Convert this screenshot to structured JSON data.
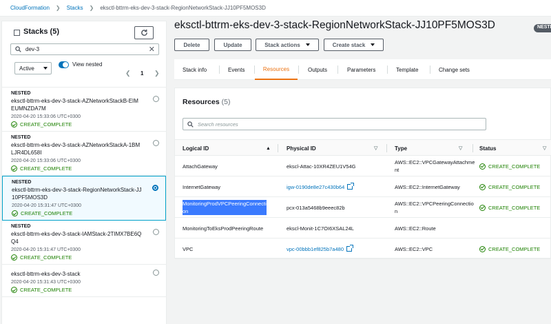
{
  "breadcrumb": {
    "root": "CloudFormation",
    "mid": "Stacks",
    "current": "eksctl-bttrm-eks-dev-3-stack-RegionNetworkStack-JJ10PF5MOS3D"
  },
  "left": {
    "title": "Stacks",
    "count": "(5)",
    "search_value": "dev-3",
    "filter_value": "Active",
    "view_nested": "View nested",
    "page": "1",
    "stacks": [
      {
        "tag": "NESTED",
        "name": "eksctl-bttrm-eks-dev-3-stack-AZNetworkStackB-EIMEUMNZDA7M",
        "date": "2020-04-20 15:33:06 UTC+0300",
        "status": "CREATE_COMPLETE",
        "selected": false
      },
      {
        "tag": "NESTED",
        "name": "eksctl-bttrm-eks-dev-3-stack-AZNetworkStackA-1BMLJR4DL658I",
        "date": "2020-04-20 15:33:06 UTC+0300",
        "status": "CREATE_COMPLETE",
        "selected": false
      },
      {
        "tag": "NESTED",
        "name": "eksctl-bttrm-eks-dev-3-stack-RegionNetworkStack-JJ10PF5MOS3D",
        "date": "2020-04-20 15:31:47 UTC+0300",
        "status": "CREATE_COMPLETE",
        "selected": true
      },
      {
        "tag": "NESTED",
        "name": "eksctl-bttrm-eks-dev-3-stack-IAMStack-2TIMX7BE6QQ4",
        "date": "2020-04-20 15:31:47 UTC+0300",
        "status": "CREATE_COMPLETE",
        "selected": false
      },
      {
        "tag": "",
        "name": "eksctl-bttrm-eks-dev-3-stack",
        "date": "2020-04-20 15:31:43 UTC+0300",
        "status": "CREATE_COMPLETE",
        "selected": false
      }
    ]
  },
  "main": {
    "title": "eksctl-bttrm-eks-dev-3-stack-RegionNetworkStack-JJ10PF5MOS3D",
    "badge": "NESTED",
    "buttons": {
      "delete": "Delete",
      "update": "Update",
      "stack_actions": "Stack actions",
      "create_stack": "Create stack"
    },
    "tabs": [
      "Stack info",
      "Events",
      "Resources",
      "Outputs",
      "Parameters",
      "Template",
      "Change sets"
    ],
    "active_tab": "Resources",
    "resources": {
      "title": "Resources",
      "count": "(5)",
      "search_placeholder": "Search resources",
      "columns": [
        "Logical ID",
        "Physical ID",
        "Type",
        "Status"
      ],
      "rows": [
        {
          "logical": "AttachGateway",
          "physical": "ekscl-Attac-10XR4ZEU1V54G",
          "link": false,
          "type": "AWS::EC2::VPCGatewayAttachment",
          "status": "CREATE_COMPLETE"
        },
        {
          "logical": "InternetGateway",
          "physical": "igw-0190de8e27c430b64",
          "link": true,
          "type": "AWS::EC2::InternetGateway",
          "status": "CREATE_COMPLETE"
        },
        {
          "logical": "MonitoringProdVPCPeeringConnection",
          "physical": "pcx-013a5468b9eeec82b",
          "link": false,
          "type": "AWS::EC2::VPCPeeringConnection",
          "status": "CREATE_COMPLETE",
          "highlight": true
        },
        {
          "logical": "MonitoringToEksProdPeeringRoute",
          "physical": "ekscl-Monit-1C7OI6XSAL24L",
          "link": false,
          "type": "AWS::EC2::Route",
          "status": ""
        },
        {
          "logical": "VPC",
          "physical": "vpc-00bbb1ef825b7a480",
          "link": true,
          "type": "AWS::EC2::VPC",
          "status": "CREATE_COMPLETE"
        }
      ]
    }
  },
  "colors": {
    "link": "#0073bb",
    "success": "#1d8102",
    "active_tab": "#ec7211",
    "selection": "#3a7afe"
  }
}
